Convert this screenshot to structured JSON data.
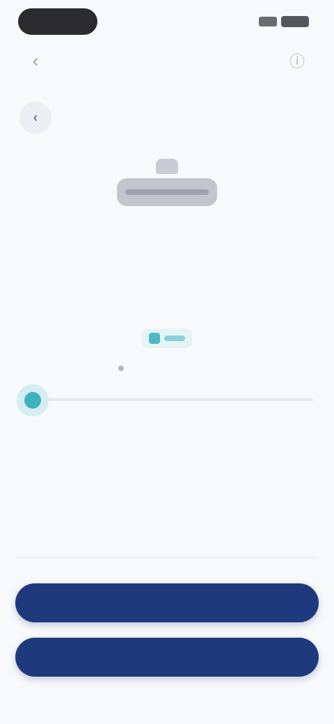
{
  "status_bar": {
    "time": "",
    "icons": [
      "signal-icon",
      "battery-icon"
    ]
  },
  "nav": {
    "back_icon": "chevron-left-icon",
    "title": "",
    "action_icon": "info-icon"
  },
  "round_button": {
    "icon": "chevron-left-icon",
    "glyph": "‹"
  },
  "hero": {
    "icon": "device-illustration"
  },
  "content": {
    "headline": "",
    "subline": "",
    "accent_chip": "",
    "link_text": ""
  },
  "slider": {
    "value": 0,
    "max_label": ""
  },
  "stats": [
    {
      "label": "",
      "value": ""
    },
    {
      "label": "",
      "value": ""
    }
  ],
  "note": {
    "title": ""
  },
  "buttons": {
    "primary": "",
    "secondary": ""
  },
  "colors": {
    "accent": "#3fb1bd",
    "primary": "#1f3a7c",
    "background": "#f8f9fb"
  }
}
